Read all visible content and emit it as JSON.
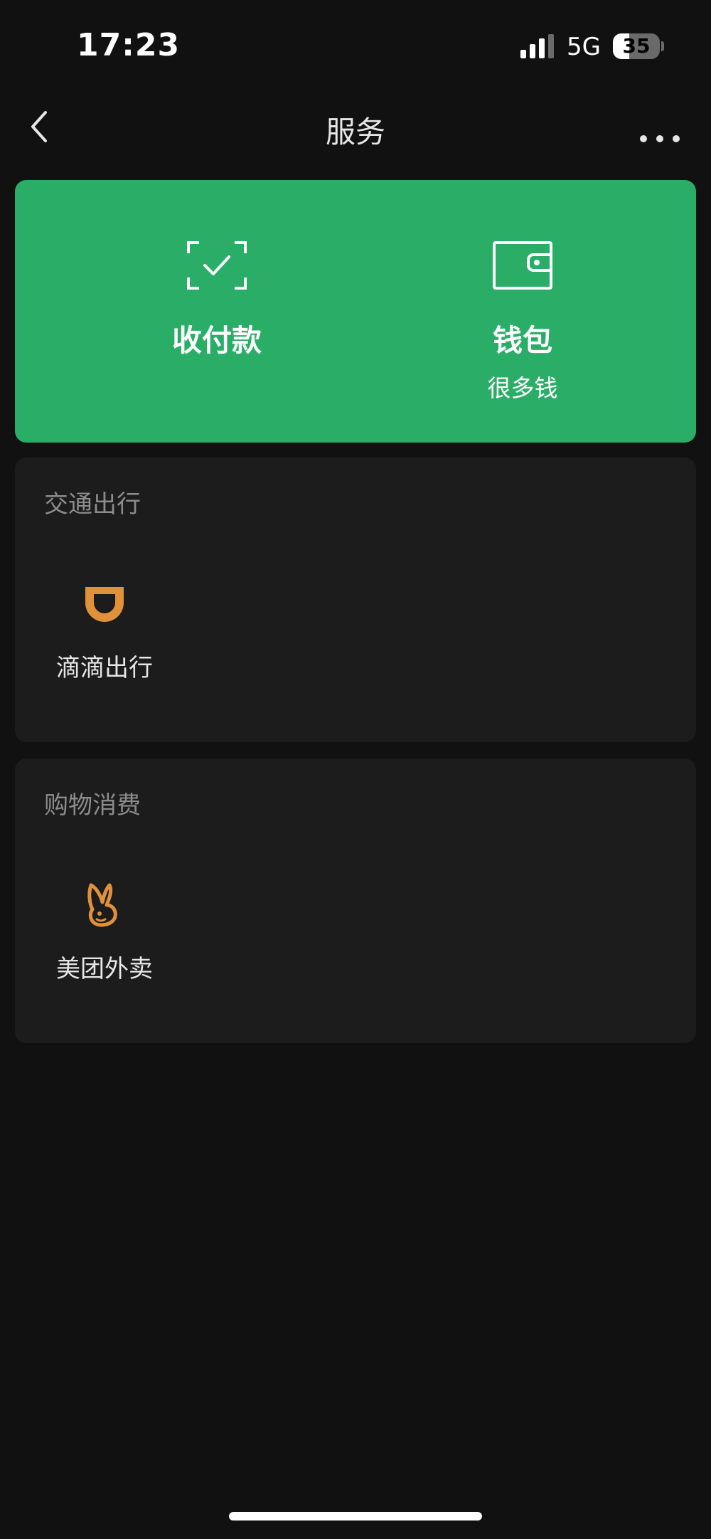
{
  "status_bar": {
    "time": "17:23",
    "network": "5G",
    "battery": "35",
    "battery_level": 0.35
  },
  "nav": {
    "title": "服务"
  },
  "pay_card": {
    "color": "#2aae67",
    "items": [
      {
        "label": "收付款",
        "icon": "scan-check-icon"
      },
      {
        "label": "钱包",
        "sub": "很多钱",
        "icon": "wallet-icon"
      }
    ]
  },
  "sections": [
    {
      "title": "交通出行",
      "items": [
        {
          "label": "滴滴出行",
          "icon": "didi-icon",
          "color": "#e0913a"
        }
      ]
    },
    {
      "title": "购物消费",
      "items": [
        {
          "label": "美团外卖",
          "icon": "meituan-rabbit-icon",
          "color": "#e0913a"
        }
      ]
    }
  ]
}
